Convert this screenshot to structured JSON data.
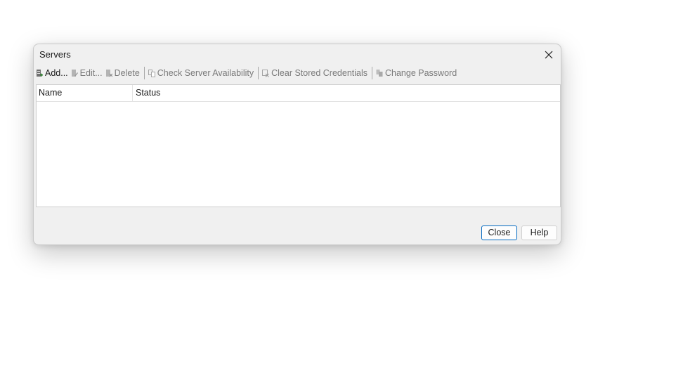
{
  "window": {
    "title": "Servers",
    "close_icon": "close-icon"
  },
  "toolbar": {
    "items": [
      {
        "label": "Add...",
        "icon": "add-server-icon",
        "enabled": true
      },
      {
        "label": "Edit...",
        "icon": "edit-server-icon",
        "enabled": false
      },
      {
        "label": "Delete",
        "icon": "delete-server-icon",
        "enabled": false
      },
      {
        "label": "Check Server Availability",
        "icon": "check-availability-icon",
        "enabled": false
      },
      {
        "label": "Clear Stored Credentials",
        "icon": "clear-credentials-icon",
        "enabled": false
      },
      {
        "label": "Change Password",
        "icon": "change-password-icon",
        "enabled": false
      }
    ]
  },
  "list": {
    "columns": [
      "Name",
      "Status"
    ],
    "rows": []
  },
  "buttons": {
    "close": "Close",
    "help": "Help"
  },
  "colors": {
    "dialog_bg": "#f0f0f0",
    "default_button_border": "#0067c0",
    "disabled_text": "#7a7a7a"
  }
}
